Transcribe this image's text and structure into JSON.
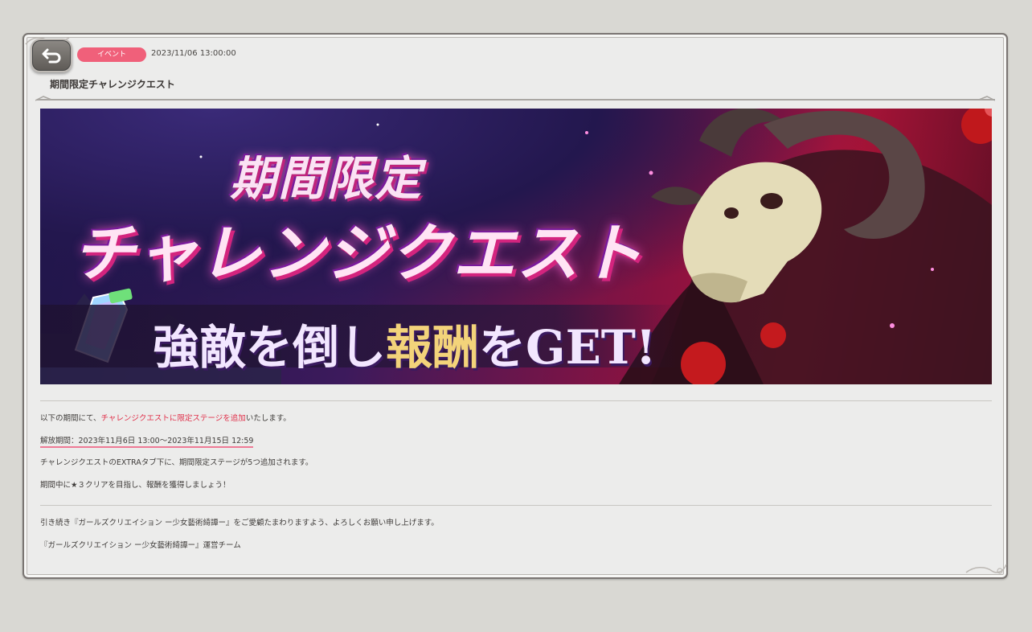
{
  "header": {
    "back_icon": "back-arrow-icon",
    "badge_label": "イベント",
    "badge_color": "#f0607a",
    "date": "2023/11/06 13:00:00",
    "title": "期間限定チャレンジクエスト"
  },
  "banner": {
    "line1": "期間限定",
    "line2": "チャレンジクエスト",
    "line3_part1": "強敵を倒し",
    "line3_part2": "報酬",
    "line3_part3": "をGET!"
  },
  "body": {
    "p1_prefix": "以下の期間にて、",
    "p1_highlight": "チャレンジクエストに限定ステージを追加",
    "p1_suffix": "いたします。",
    "p2": "解放期間：2023年11月6日 13:00〜2023年11月15日 12:59",
    "p3": "チャレンジクエストのEXTRAタブ下に、期間限定ステージが5つ追加されます。",
    "p4": "期間中に★３クリアを目指し、報酬を獲得しましょう！",
    "p5": "引き続き『ガールズクリエイション ー少女藝術綺譚ー』をご愛顧たまわりますよう、よろしくお願い申し上げます。",
    "p6": "『ガールズクリエイション ー少女藝術綺譚ー』運営チーム"
  }
}
